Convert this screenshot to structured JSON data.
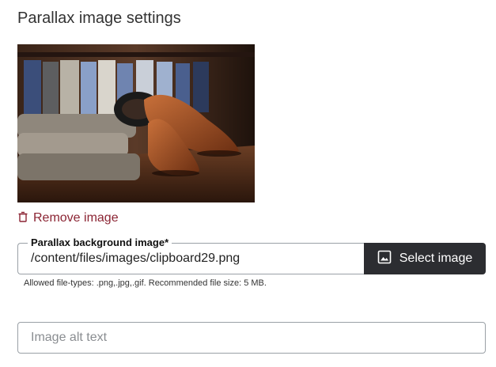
{
  "section": {
    "title": "Parallax image settings"
  },
  "preview": {
    "image_name": "preview-image"
  },
  "remove": {
    "label": "Remove image",
    "icon": "trash-icon",
    "color": "#8b2433"
  },
  "file_input": {
    "label": "Parallax background image*",
    "value": "/content/files/images/clipboard29.png"
  },
  "select_button": {
    "label": "Select image",
    "icon": "image-icon",
    "color": "#2c2d31"
  },
  "hint": {
    "text": "Allowed file-types: .png,.jpg,.gif. Recommended file size: 5 MB."
  },
  "alt_text": {
    "placeholder": "Image alt text",
    "value": ""
  }
}
